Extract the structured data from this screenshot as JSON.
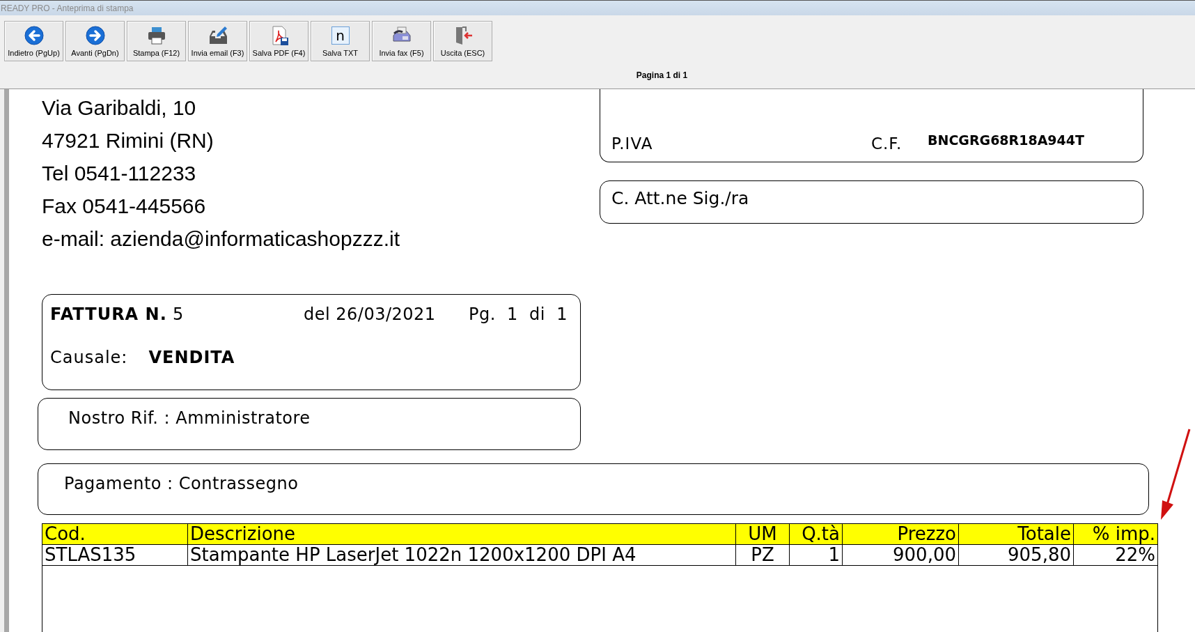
{
  "window": {
    "title": "READY PRO - Anteprima di stampa"
  },
  "toolbar": [
    {
      "kind": "back",
      "label": "Indietro (PgUp)"
    },
    {
      "kind": "forward",
      "label": "Avanti (PgDn)"
    },
    {
      "kind": "print",
      "label": "Stampa (F12)"
    },
    {
      "kind": "email",
      "label": "Invia email (F3)"
    },
    {
      "kind": "pdf",
      "label": "Salva PDF (F4)"
    },
    {
      "kind": "txt",
      "label": "Salva TXT",
      "icon_text": "n"
    },
    {
      "kind": "fax",
      "label": "Invia fax (F5)"
    },
    {
      "kind": "exit",
      "label": "Uscita (ESC)"
    }
  ],
  "page_indicator": "Pagina 1 di 1",
  "sender": [
    "Via Garibaldi, 10",
    "47921 Rimini (RN)",
    "Tel 0541-112233",
    "Fax 0541-445566",
    "e-mail: azienda@informaticashopzzz.it"
  ],
  "customer": {
    "piva_label": "P.IVA",
    "cf_label": "C.F.",
    "cf_value": "BNCGRG68R18A944T",
    "attention": "C. Att.ne Sig./ra"
  },
  "invoice": {
    "label": "FATTURA N.",
    "number": "5",
    "date": "del 26/03/2021",
    "page": "Pg.  1  di  1",
    "reason_label": "Causale:",
    "reason": "VENDITA"
  },
  "reference": "Nostro Rif. : Amministratore",
  "payment": "Pagamento : Contrassegno",
  "table": {
    "columns": [
      "Cod.",
      "Descrizione",
      "UM",
      "Q.tà",
      "Prezzo",
      "Totale",
      "% imp."
    ],
    "rows": [
      [
        "STLAS135",
        "Stampante HP LaserJet 1022n 1200x1200 DPI A4",
        "PZ",
        "1",
        "900,00",
        "905,80",
        "22%"
      ]
    ]
  }
}
